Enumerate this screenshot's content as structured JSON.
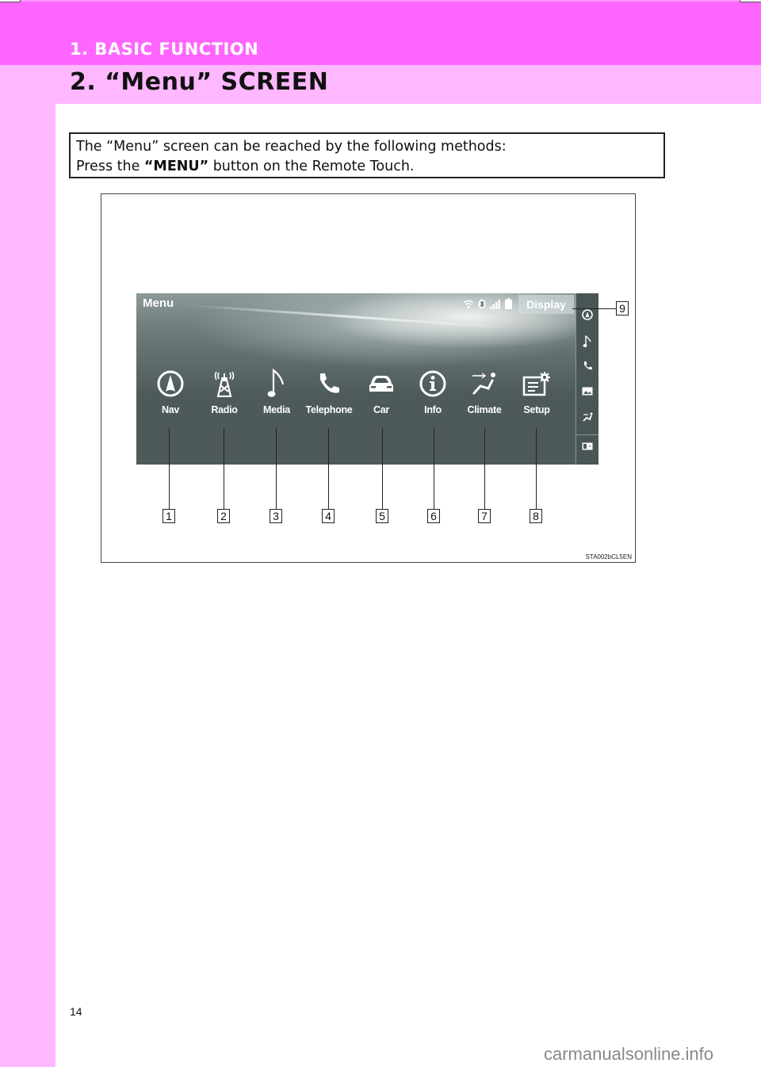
{
  "header": {
    "section": "1. BASIC FUNCTION",
    "title": "2. “Menu” SCREEN"
  },
  "intro": {
    "line1": "The “Menu” screen can be reached by the following methods:",
    "line2_prefix": "Press the ",
    "line2_bold": "“MENU”",
    "line2_suffix": " button on the Remote Touch."
  },
  "screen": {
    "title": "Menu",
    "status_icons": [
      "wifi-icon",
      "bluetooth-icon",
      "signal-icon",
      "battery-icon"
    ],
    "display_button": "Display",
    "apps": [
      {
        "label": "Nav",
        "icon": "nav-icon",
        "callout": "1"
      },
      {
        "label": "Radio",
        "icon": "radio-tower-icon",
        "callout": "2"
      },
      {
        "label": "Media",
        "icon": "music-note-icon",
        "callout": "3"
      },
      {
        "label": "Telephone",
        "icon": "phone-icon",
        "callout": "4"
      },
      {
        "label": "Car",
        "icon": "car-icon",
        "callout": "5"
      },
      {
        "label": "Info",
        "icon": "info-icon",
        "callout": "6"
      },
      {
        "label": "Climate",
        "icon": "climate-seat-icon",
        "callout": "7"
      },
      {
        "label": "Setup",
        "icon": "setup-gear-icon",
        "callout": "8"
      }
    ],
    "side_icons": [
      "nav-icon",
      "music-note-icon",
      "phone-icon",
      "image-icon",
      "climate-seat-icon",
      "split-screen-icon"
    ],
    "display_callout": "9"
  },
  "figure_code": "STA002bCL5EN",
  "page_number": "14",
  "watermark": "carmanualsonline.info",
  "colors": {
    "section_band": "#ff66ff",
    "title_band": "#ffb8ff",
    "screen_bg": "#4e5a5a"
  }
}
